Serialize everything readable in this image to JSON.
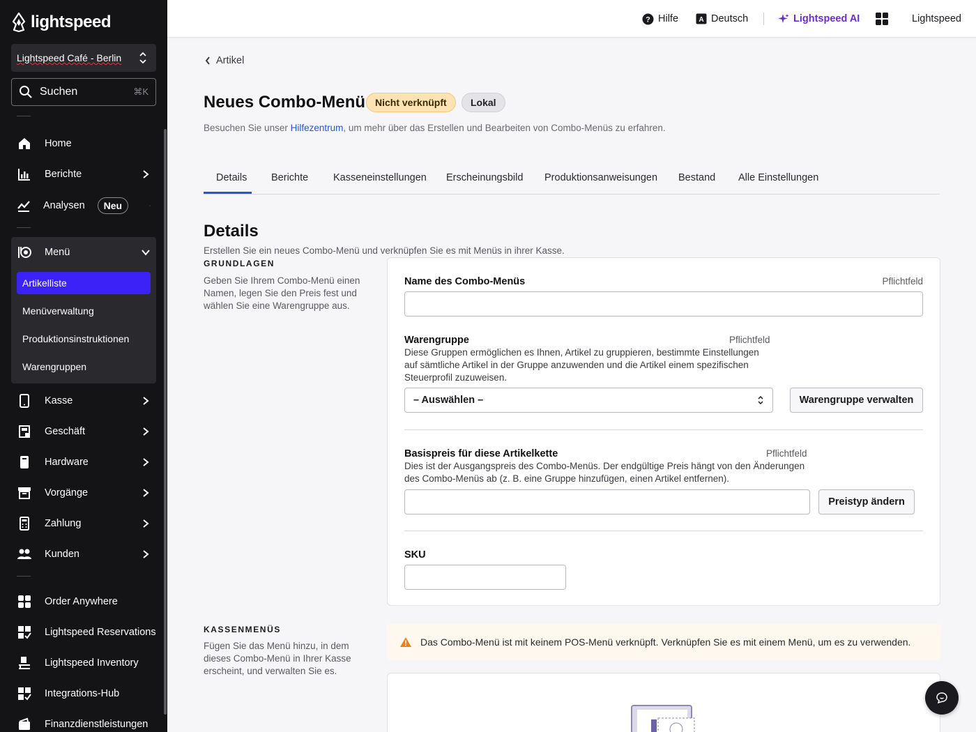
{
  "brand": {
    "name": "lightspeed"
  },
  "sidebar": {
    "location": "Lightspeed Café - Berlin",
    "search": {
      "label": "Suchen",
      "shortcut": "⌘K"
    },
    "items": [
      {
        "label": "Home",
        "icon": "home-icon"
      },
      {
        "label": "Berichte",
        "icon": "bar-chart-icon"
      },
      {
        "label": "Analysen",
        "icon": "trend-icon",
        "badge": "Neu"
      },
      {
        "label": "Menü",
        "icon": "menu-book-icon"
      },
      {
        "label": "Kasse",
        "icon": "tablet-icon"
      },
      {
        "label": "Geschäft",
        "icon": "store-icon"
      },
      {
        "label": "Hardware",
        "icon": "device-icon"
      },
      {
        "label": "Vorgänge",
        "icon": "archive-icon"
      },
      {
        "label": "Zahlung",
        "icon": "calculator-icon"
      },
      {
        "label": "Kunden",
        "icon": "people-icon"
      }
    ],
    "menu_sub": [
      "Artikelliste",
      "Menüverwaltung",
      "Produktionsinstruktionen",
      "Warengruppen"
    ],
    "apps": [
      {
        "label": "Order Anywhere",
        "icon": "order-anywhere-icon"
      },
      {
        "label": "Lightspeed Reservations",
        "icon": "reservations-icon"
      },
      {
        "label": "Lightspeed Inventory",
        "icon": "inventory-icon"
      },
      {
        "label": "Integrations-Hub",
        "icon": "integrations-icon"
      },
      {
        "label": "Finanzdienstleistungen",
        "icon": "wallet-icon"
      }
    ]
  },
  "topbar": {
    "help": "Hilfe",
    "language": "Deutsch",
    "ai": "Lightspeed AI",
    "account": "Lightspeed"
  },
  "page": {
    "back": "Artikel",
    "title": "Neues Combo-Menü",
    "status_badge": "Nicht verknüpft",
    "scope_badge": "Lokal",
    "help_prefix": "Besuchen Sie unser ",
    "help_link": "Hilfezentrum",
    "help_suffix": ", um mehr über das Erstellen und Bearbeiten von Combo-Menüs zu erfahren.",
    "tabs": [
      "Details",
      "Berichte",
      "Kasseneinstellungen",
      "Erscheinungsbild",
      "Produktionsanweisungen",
      "Bestand",
      "Alle Einstellungen"
    ],
    "section_title": "Details",
    "section_sub": "Erstellen Sie ein neues Combo-Menü und verknüpfen Sie es mit Menüs in ihrer Kasse."
  },
  "basics": {
    "heading": "GRUNDLAGEN",
    "desc": "Geben Sie Ihrem Combo-Menü einen Namen, legen Sie den Preis fest und wählen Sie eine Warengruppe aus.",
    "name_label": "Name des Combo-Menüs",
    "required": "Pflichtfeld",
    "name_value": "",
    "group_label": "Warengruppe",
    "group_help": "Diese Gruppen ermöglichen es Ihnen, Artikel zu gruppieren, bestimmte Einstellungen auf sämtliche Artikel in der Gruppe anzuwenden und die Artikel einem spezifischen Steuerprofil zuzuweisen.",
    "group_select": "– Auswählen –",
    "group_manage": "Warengruppe verwalten",
    "price_label": "Basispreis für diese Artikelkette",
    "price_help": "Dies ist der Ausgangspreis des Combo-Menüs. Der endgültige Preis hängt von den Änderungen des Combo-Menüs ab (z. B. eine Gruppe hinzufügen, einen Artikel entfernen).",
    "price_value": "",
    "price_type": "Preistyp ändern",
    "sku_label": "SKU",
    "sku_value": ""
  },
  "pos_menus": {
    "heading": "KASSENMENÜS",
    "desc": "Fügen Sie das Menü hinzu, in dem dieses Combo-Menü in Ihrer Kasse erscheint, und verwalten Sie es.",
    "alert": "Das Combo-Menü ist mit keinem POS-Menü verknüpft. Verknüpfen Sie es mit einem Menü, um es zu verwenden."
  },
  "colors": {
    "accent": "#3b23f7",
    "link": "#2456d6",
    "ai": "#6c2ec8",
    "warn_badge": "#fde3b3",
    "alert_icon": "#e8821e"
  }
}
